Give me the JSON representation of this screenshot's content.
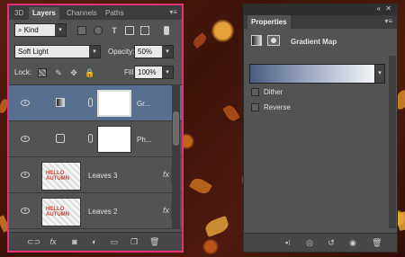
{
  "layers_panel": {
    "tabs": [
      "3D",
      "Layers",
      "Channels",
      "Paths"
    ],
    "active_tab": "Layers",
    "filter_kind": "Kind",
    "blend_mode": "Soft Light",
    "opacity_label": "Opacity:",
    "opacity_value": "50%",
    "lock_label": "Lock:",
    "fill_label": "Fill:",
    "fill_value": "100%",
    "layers": [
      {
        "name": "Gr...",
        "kind": "gradient-map-adjustment",
        "selected": true
      },
      {
        "name": "Ph...",
        "kind": "photo-filter-adjustment",
        "selected": false
      },
      {
        "name": "Leaves 3",
        "kind": "pixel",
        "thumb_text": "HELLO AUTUMN",
        "fx": "fx",
        "selected": false
      },
      {
        "name": "Leaves 2",
        "kind": "pixel",
        "thumb_text": "HELLO AUTUMN",
        "fx": "fx",
        "selected": false
      }
    ]
  },
  "properties_panel": {
    "title": "Properties",
    "adjustment_name": "Gradient Map",
    "gradient_colors": [
      "#4b5b7d",
      "#9aa8c2",
      "#f5f6f8"
    ],
    "dither_label": "Dither",
    "dither_checked": false,
    "reverse_label": "Reverse",
    "reverse_checked": false
  },
  "colors": {
    "panel_bg": "#535353",
    "selected_layer": "#58708f",
    "highlight_border": "#e6307a"
  }
}
